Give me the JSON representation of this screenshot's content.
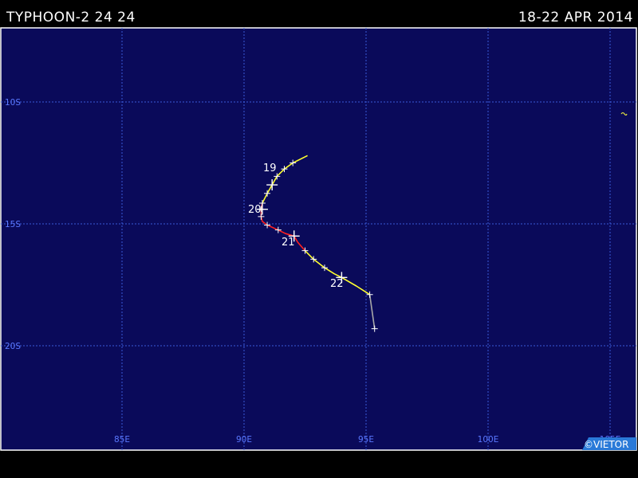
{
  "header": {
    "title": "TYPHOON-2 24 24",
    "date_range": "18-22 APR 2014"
  },
  "map": {
    "background_color": "#0a0a5a",
    "grid_color": "#3a5ad8",
    "label_color": "#5a78ff",
    "lon_labels": [
      "85E",
      "90E",
      "95E",
      "100E",
      "105E"
    ],
    "lat_labels": [
      "10S",
      "15S",
      "20S"
    ],
    "copyright": "©VIETOR",
    "copyright_bg": "#2a7ad8"
  },
  "track": {
    "day_labels": [
      "19",
      "20",
      "21",
      "22"
    ],
    "segments": [
      {
        "category": "extratropical",
        "color": "#a8a8a8",
        "points": [
          [
            95.35,
            -19.3
          ],
          [
            95.15,
            -17.9
          ]
        ]
      },
      {
        "category": "storm",
        "color": "#ffff30",
        "points": [
          [
            95.15,
            -17.9
          ],
          [
            94.6,
            -17.55
          ],
          [
            94.0,
            -17.2
          ],
          [
            93.7,
            -17.05
          ],
          [
            93.3,
            -16.8
          ],
          [
            92.85,
            -16.45
          ],
          [
            92.5,
            -16.1
          ]
        ]
      },
      {
        "category": "typhoon",
        "color": "#ff2020",
        "points": [
          [
            92.5,
            -16.1
          ],
          [
            92.2,
            -15.75
          ],
          [
            92.05,
            -15.5
          ],
          [
            91.7,
            -15.4
          ],
          [
            91.4,
            -15.25
          ],
          [
            90.95,
            -15.05
          ],
          [
            90.75,
            -14.9
          ],
          [
            90.7,
            -14.7
          ],
          [
            90.7,
            -14.4
          ],
          [
            90.75,
            -14.15
          ]
        ]
      },
      {
        "category": "storm",
        "color": "#ffff30",
        "points": [
          [
            90.75,
            -14.15
          ],
          [
            90.95,
            -13.75
          ],
          [
            91.15,
            -13.4
          ],
          [
            91.35,
            -13.05
          ],
          [
            91.65,
            -12.75
          ],
          [
            92.0,
            -12.5
          ],
          [
            92.6,
            -12.2
          ]
        ]
      }
    ],
    "markers": [
      [
        95.35,
        -19.3
      ],
      [
        95.15,
        -17.9
      ],
      [
        94.0,
        -17.2
      ],
      [
        93.3,
        -16.8
      ],
      [
        92.85,
        -16.45
      ],
      [
        92.5,
        -16.1
      ],
      [
        92.05,
        -15.5
      ],
      [
        91.4,
        -15.25
      ],
      [
        90.95,
        -15.05
      ],
      [
        90.7,
        -14.7
      ],
      [
        90.7,
        -14.4
      ],
      [
        90.75,
        -14.15
      ],
      [
        90.95,
        -13.75
      ],
      [
        91.15,
        -13.4
      ],
      [
        91.35,
        -13.05
      ],
      [
        91.65,
        -12.75
      ],
      [
        92.0,
        -12.5
      ]
    ],
    "day_markers": [
      [
        91.15,
        -13.4
      ],
      [
        90.75,
        -14.4
      ],
      [
        92.05,
        -15.5
      ],
      [
        94.0,
        -17.2
      ]
    ]
  }
}
